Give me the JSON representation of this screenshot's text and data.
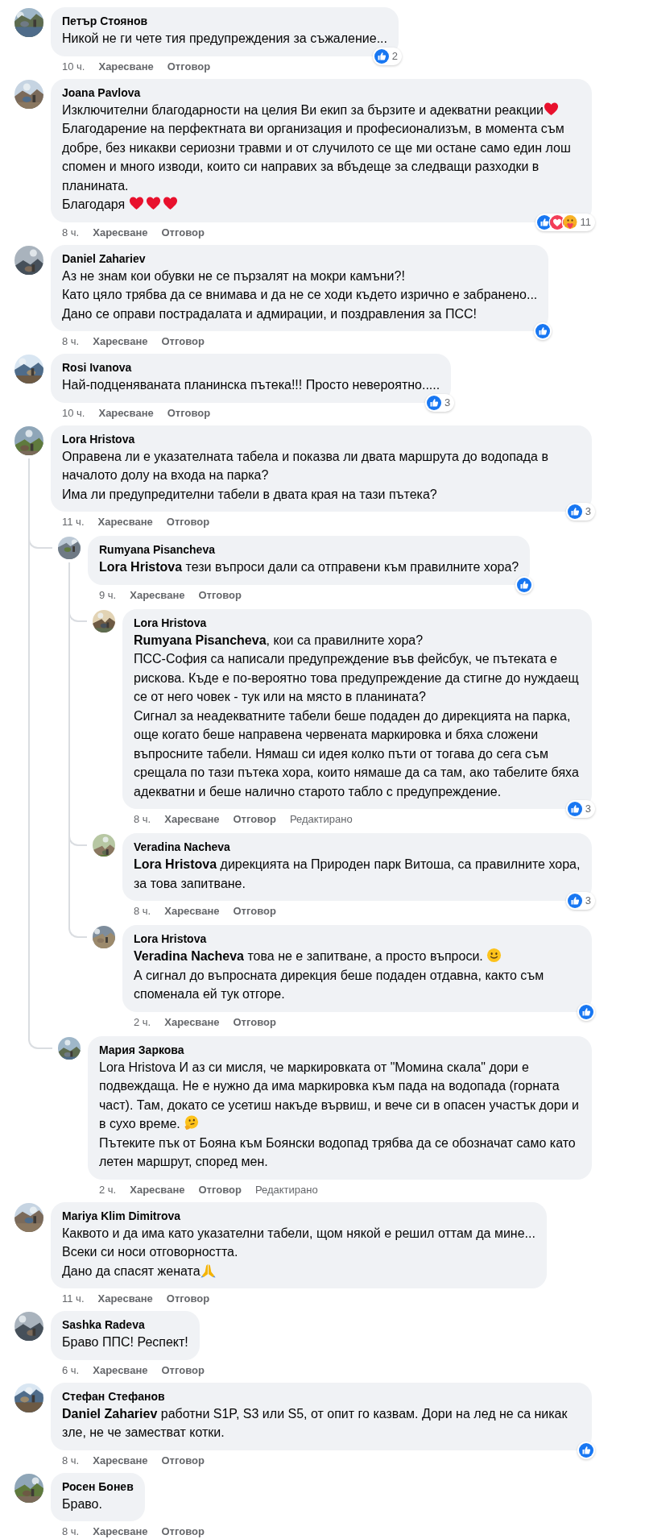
{
  "comments": [
    {
      "name": "Петър Стоянов",
      "paragraphs": [
        {
          "text": "Никой не ги чете тия предупреждения за съжаление..."
        }
      ],
      "time": "10 ч.",
      "actions": [
        "Харесване",
        "Отговор"
      ],
      "reactions": {
        "types": [
          {
            "kind": "like"
          }
        ],
        "count": "2"
      }
    },
    {
      "name": "Joana Pavlova",
      "paragraphs": [
        {
          "text": "Изключителни благодарности на целия Ви екип за бързите и адекватни реакции",
          "emojis": [
            {
              "kind": "heart"
            }
          ]
        },
        {
          "text": "Благодарение на перфектната ви организация и професионализъм, в момента съм добре, без никакви сериозни травми и от случилото се ще ми остане само един лош спомен и много изводи, които си направих за вбъдеще за следващи разходки в планината."
        },
        {
          "text": "Благодаря ",
          "emojis": [
            {
              "kind": "heart"
            },
            {
              "kind": "heart"
            },
            {
              "kind": "heart"
            }
          ]
        }
      ],
      "time": "8 ч.",
      "actions": [
        "Харесване",
        "Отговор"
      ],
      "reactions": {
        "types": [
          {
            "kind": "like"
          },
          {
            "kind": "love"
          },
          {
            "kind": "care"
          }
        ],
        "count": "11"
      }
    },
    {
      "name": "Daniel Zahariev",
      "paragraphs": [
        {
          "text": "Аз не знам кои обувки не се пързалят на мокри камъни?!"
        },
        {
          "text": "Като цяло трябва да се внимава и да не се ходи където изрично е забранено..."
        },
        {
          "text": "Дано се оправи пострадалата и адмирации, и поздравления за ПСС!"
        }
      ],
      "time": "8 ч.",
      "actions": [
        "Харесване",
        "Отговор"
      ],
      "reactions": {
        "types": [
          {
            "kind": "like"
          }
        ]
      }
    },
    {
      "name": "Rosi Ivanova",
      "paragraphs": [
        {
          "text": "Най-подценяваната планинска пътека!!! Просто невероятно....."
        }
      ],
      "time": "10 ч.",
      "actions": [
        "Харесване",
        "Отговор"
      ],
      "reactions": {
        "types": [
          {
            "kind": "like"
          }
        ],
        "count": "3"
      }
    },
    {
      "name": "Lora Hristova",
      "paragraphs": [
        {
          "text": "Оправена ли е указателната табела и показва ли двата маршрута до водопада в началото долу на входа на парка?"
        },
        {
          "text": "Има ли предупредителни табели в двата края на тази пътека?"
        }
      ],
      "time": "11 ч.",
      "actions": [
        "Харесване",
        "Отговор"
      ],
      "reactions": {
        "types": [
          {
            "kind": "like"
          }
        ],
        "count": "3"
      },
      "replies": [
        {
          "name": "Rumyana Pisancheva",
          "paragraphs": [
            {
              "mention": "Lora Hristova",
              "text": " тези въпроси дали са отправени към правилните хора?"
            }
          ],
          "time": "9 ч.",
          "actions": [
            "Харесване",
            "Отговор"
          ],
          "reactions": {
            "types": [
              {
                "kind": "like"
              }
            ]
          },
          "replies": [
            {
              "name": "Lora Hristova",
              "paragraphs": [
                {
                  "mention": "Rumyana Pisancheva",
                  "text": ", кои са правилните хора?"
                },
                {
                  "text": "ПСС-София са написали предупреждение във фейсбук, че пътеката е рискова. Къде е по-вероятно това предупреждение да стигне до нуждаещ се от него човек - тук или на място в планината?"
                },
                {
                  "text": "Сигнал за неадекватните табели беше подаден до дирекцията на парка, още когато беше направена червената маркировка и бяха сложени въпросните табели. Нямаш си идея колко пъти от тогава до сега съм срещала по тази пътека хора, които нямаше да са там, ако табелите бяха адекватни и беше налично старото табло с предупреждение."
                }
              ],
              "time": "8 ч.",
              "actions": [
                "Харесване",
                "Отговор"
              ],
              "edited": "Редактирано",
              "reactions": {
                "types": [
                  {
                    "kind": "like"
                  }
                ],
                "count": "3"
              }
            },
            {
              "name": "Veradina Nacheva",
              "paragraphs": [
                {
                  "mention": "Lora Hristova",
                  "text": " дирекцията на Природен парк Витоша, са правилните хора, за това запитване."
                }
              ],
              "time": "8 ч.",
              "actions": [
                "Харесване",
                "Отговор"
              ],
              "reactions": {
                "types": [
                  {
                    "kind": "like"
                  }
                ],
                "count": "3"
              }
            },
            {
              "name": "Lora Hristova",
              "paragraphs": [
                {
                  "mention": "Veradina Nacheva",
                  "text": " това не е запитване, а просто въпроси. ",
                  "emojis": [
                    {
                      "kind": "smiley"
                    }
                  ]
                },
                {
                  "text": "А сигнал до въпросната дирекция беше подаден отдавна, както съм споменала ей тук отгоре."
                }
              ],
              "time": "2 ч.",
              "actions": [
                "Харесване",
                "Отговор"
              ],
              "reactions": {
                "types": [
                  {
                    "kind": "like"
                  }
                ]
              }
            }
          ]
        },
        {
          "name": "Мария Заркова",
          "paragraphs": [
            {
              "text": "Lora Hristova И аз си мисля, че маркировката от \"Момина скала\" дори е подвеждаща. Не е нужно да има маркировка към пада на водопада (горната част). Там, докато се усетиш накъде вървиш, и вече си в опасен участък дори и в сухо време. ",
              "emojis": [
                {
                  "kind": "thinking"
                }
              ]
            },
            {
              "text": "Пътеките пък от Бояна към Боянски водопад трябва да се обозначат само като летен маршрут, според мен."
            }
          ],
          "time": "2 ч.",
          "actions": [
            "Харесване",
            "Отговор"
          ],
          "edited": "Редактирано"
        }
      ]
    },
    {
      "name": "Mariya Klim Dimitrova",
      "paragraphs": [
        {
          "text": "Каквото и да има като указателни табели, щом някой е решил оттам да мине..."
        },
        {
          "text": "Всеки си носи отговорността."
        },
        {
          "text": "Дано да спасят жената",
          "emojis": [
            {
              "kind": "pray"
            }
          ]
        }
      ],
      "time": "11 ч.",
      "actions": [
        "Харесване",
        "Отговор"
      ]
    },
    {
      "name": "Sashka Radeva",
      "paragraphs": [
        {
          "text": "Браво ППС! Респект!"
        }
      ],
      "time": "6 ч.",
      "actions": [
        "Харесване",
        "Отговор"
      ]
    },
    {
      "name": "Стефан Стефанов",
      "paragraphs": [
        {
          "mention": "Daniel Zahariev",
          "text": " работни S1P, S3 или S5, от опит го казвам. Дори на лед не са никак зле, не че заместват котки."
        }
      ],
      "time": "8 ч.",
      "actions": [
        "Харесване",
        "Отговор"
      ],
      "reactions": {
        "types": [
          {
            "kind": "like"
          }
        ]
      }
    },
    {
      "name": "Росен Бонев",
      "paragraphs": [
        {
          "text": "Браво."
        }
      ],
      "time": "8 ч.",
      "actions": [
        "Харесване",
        "Отговор"
      ]
    }
  ]
}
